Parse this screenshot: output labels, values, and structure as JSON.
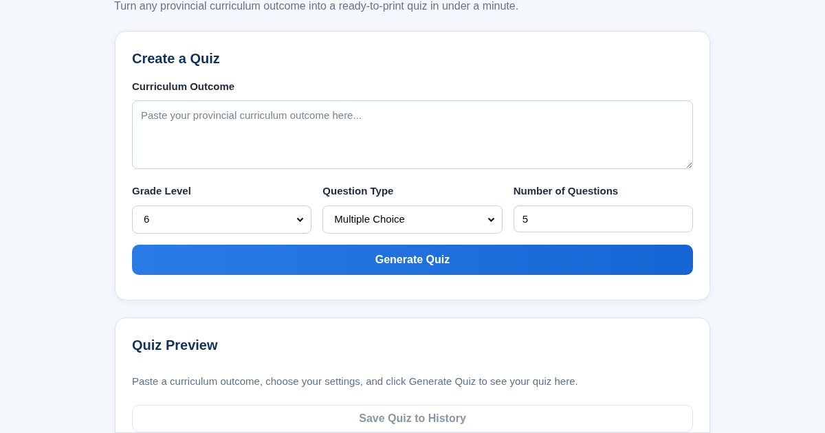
{
  "subtitle": "Turn any provincial curriculum outcome into a ready-to-print quiz in under a minute.",
  "create_card": {
    "title": "Create a Quiz",
    "outcome": {
      "label": "Curriculum Outcome",
      "placeholder": "Paste your provincial curriculum outcome here..."
    },
    "fields": [
      {
        "kind": "select",
        "label": "Grade Level",
        "value": "6"
      },
      {
        "kind": "select",
        "label": "Question Type",
        "value": "Multiple Choice"
      },
      {
        "kind": "number",
        "label": "Number of Questions",
        "value": "5"
      }
    ],
    "button": "Generate Quiz"
  },
  "preview_card": {
    "title": "Quiz Preview",
    "message": "Paste a curriculum outcome, choose your settings, and click Generate Quiz to see your quiz here.",
    "save_button": {
      "label": "Save Quiz to History",
      "disabled": true
    }
  }
}
